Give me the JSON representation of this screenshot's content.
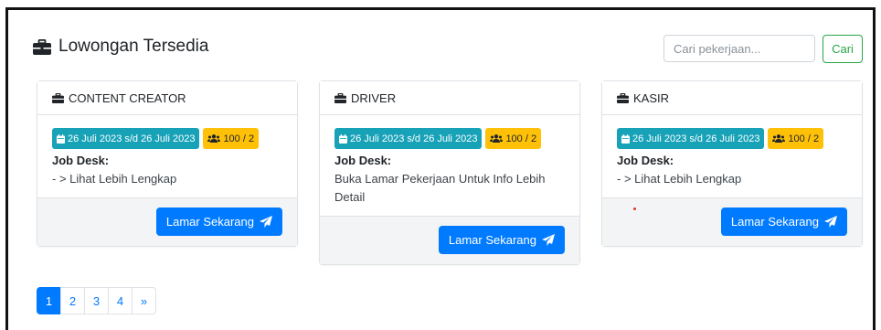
{
  "header": {
    "title": "Lowongan Tersedia",
    "icon": "briefcase-icon"
  },
  "search": {
    "placeholder": "Cari pekerjaan...",
    "button_label": "Cari"
  },
  "jobs": [
    {
      "title": "CONTENT CREATOR",
      "date": "26 Juli 2023 s/d 26 Juli 2023",
      "count": "100 / 2",
      "job_desk_label": "Job Desk:",
      "job_desk": "- > Lihat Lebih Lengkap",
      "apply_label": "Lamar Sekarang"
    },
    {
      "title": "DRIVER",
      "date": "26 Juli 2023 s/d 26 Juli 2023",
      "count": "100 / 2",
      "job_desk_label": "Job Desk:",
      "job_desk": "Buka Lamar Pekerjaan Untuk Info Lebih Detail",
      "apply_label": "Lamar Sekarang"
    },
    {
      "title": "KASIR",
      "date": "26 Juli 2023 s/d 26 Juli 2023",
      "count": "100 / 2",
      "job_desk_label": "Job Desk:",
      "job_desk": "- > Lihat Lebih Lengkap",
      "apply_label": "Lamar Sekarang"
    }
  ],
  "pagination": {
    "pages": [
      "1",
      "2",
      "3",
      "4"
    ],
    "next": "»",
    "active": "1"
  },
  "colors": {
    "primary": "#007bff",
    "info": "#17a2b8",
    "warning": "#ffc107",
    "success": "#28a745"
  }
}
